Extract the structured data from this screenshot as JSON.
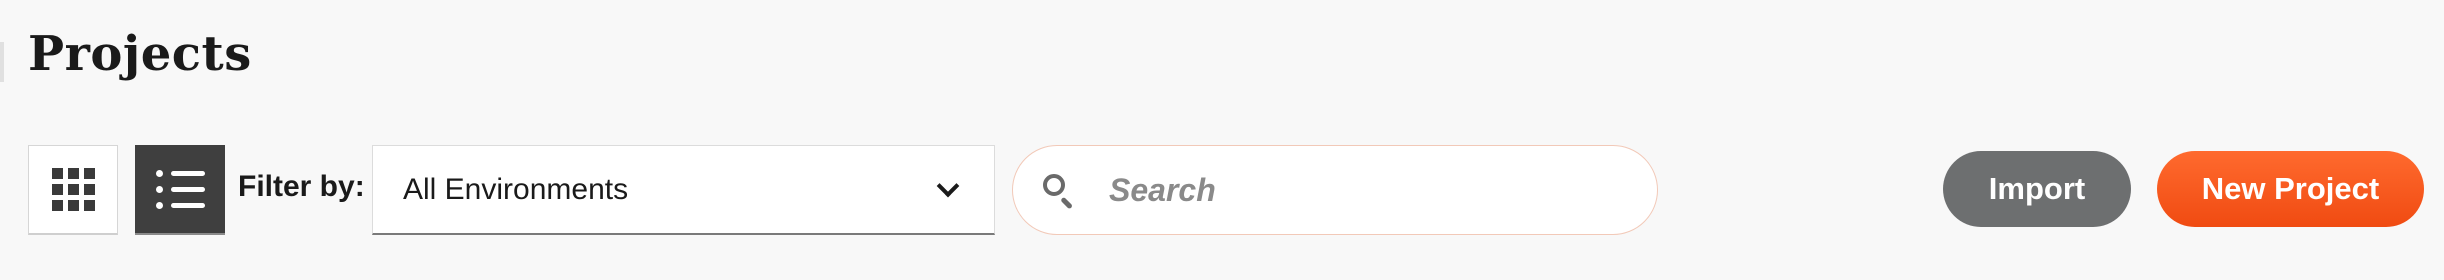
{
  "header": {
    "title": "Projects"
  },
  "toolbar": {
    "grid_view_icon": "grid-icon",
    "list_view_icon": "list-icon",
    "active_view": "list",
    "filter_label": "Filter by:",
    "filter_value": "All Environments",
    "filter_chevron_icon": "chevron-down-icon",
    "search_icon": "search-icon",
    "search_placeholder": "Search",
    "search_value": "",
    "import_label": "Import",
    "new_project_label": "New Project"
  },
  "colors": {
    "background": "#f8f8f8",
    "active_view_bg": "#3f3f3f",
    "import_bg": "#6d6f70",
    "accent": "#f4561c",
    "search_border": "#f2c9b8"
  }
}
